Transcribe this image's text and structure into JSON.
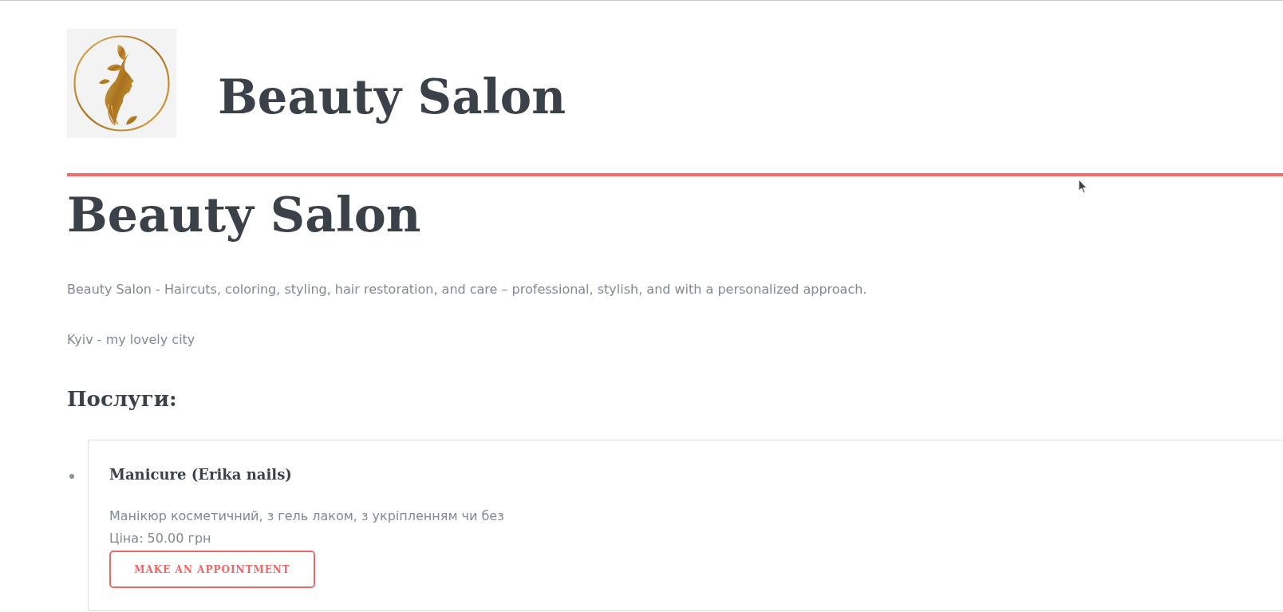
{
  "header": {
    "site_title": "Beauty Salon"
  },
  "page": {
    "title": "Beauty Salon",
    "paragraphs": [
      "Beauty Salon - Haircuts, coloring, styling, hair restoration, and care – professional, stylish, and with a personalized approach.",
      "Kyiv - my lovely city"
    ],
    "services_heading": "Послуги:"
  },
  "services": [
    {
      "name": "Manicure (Erika nails)",
      "description": "Манікюр косметичний, з гель лаком, з укріпленням чи без",
      "price": "Ціна: 50.00 грн",
      "button": "MAKE AN APPOINTMENT"
    }
  ]
}
